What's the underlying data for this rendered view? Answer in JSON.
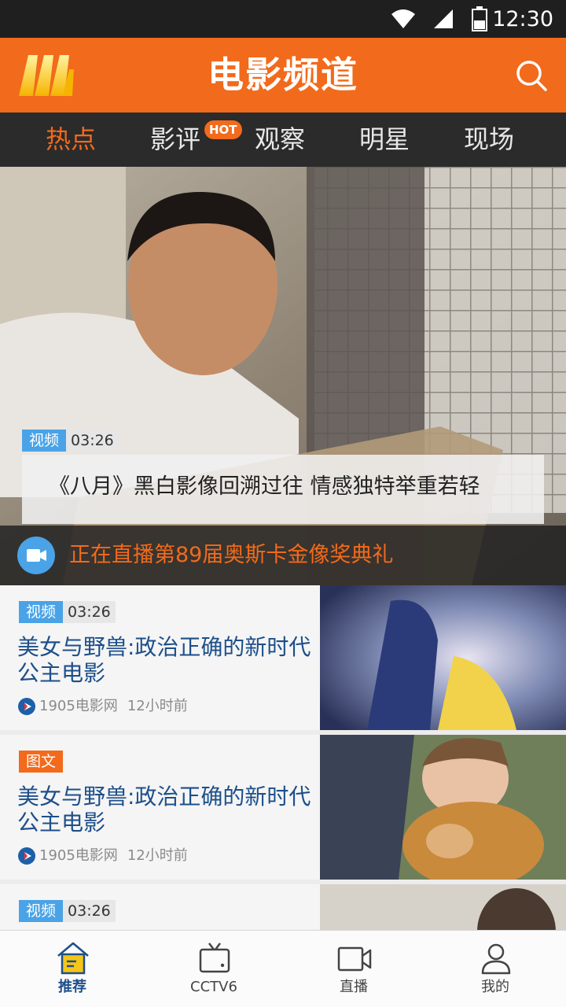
{
  "status_bar": {
    "time": "12:30",
    "icons": [
      "wifi-icon",
      "cell-signal-icon",
      "battery-icon"
    ]
  },
  "header": {
    "title": "电影频道",
    "logo": "m-logo",
    "search_icon": "search-icon"
  },
  "tabs": [
    {
      "label": "热点",
      "active": true
    },
    {
      "label": "影评",
      "badge": "HOT"
    },
    {
      "label": "观察"
    },
    {
      "label": "明星"
    },
    {
      "label": "现场"
    }
  ],
  "hero": {
    "badge": {
      "type": "视频",
      "duration": "03:26"
    },
    "caption": "《八月》黑白影像回溯过往 情感独特举重若轻",
    "live_text": "正在直播第89届奥斯卡金像奖典礼"
  },
  "news": [
    {
      "badge": {
        "type": "视频",
        "duration": "03:26"
      },
      "title": "美女与野兽:政治正确的新时代公主电影",
      "source": "1905电影网",
      "time": "12小时前"
    },
    {
      "badge": {
        "type": "图文"
      },
      "title": "美女与野兽:政治正确的新时代公主电影",
      "source": "1905电影网",
      "time": "12小时前"
    },
    {
      "badge": {
        "type": "视频",
        "duration": "03:26"
      }
    }
  ],
  "bottom_nav": [
    {
      "label": "推荐",
      "icon": "home-icon",
      "active": true
    },
    {
      "label": "CCTV6",
      "icon": "tv-icon"
    },
    {
      "label": "直播",
      "icon": "video-camera-icon"
    },
    {
      "label": "我的",
      "icon": "user-icon"
    }
  ],
  "colors": {
    "accent": "#f26a1b",
    "video_badge": "#4aa3e6",
    "title_blue": "#1d4f8a",
    "dark_bar": "#2b2b2b"
  }
}
